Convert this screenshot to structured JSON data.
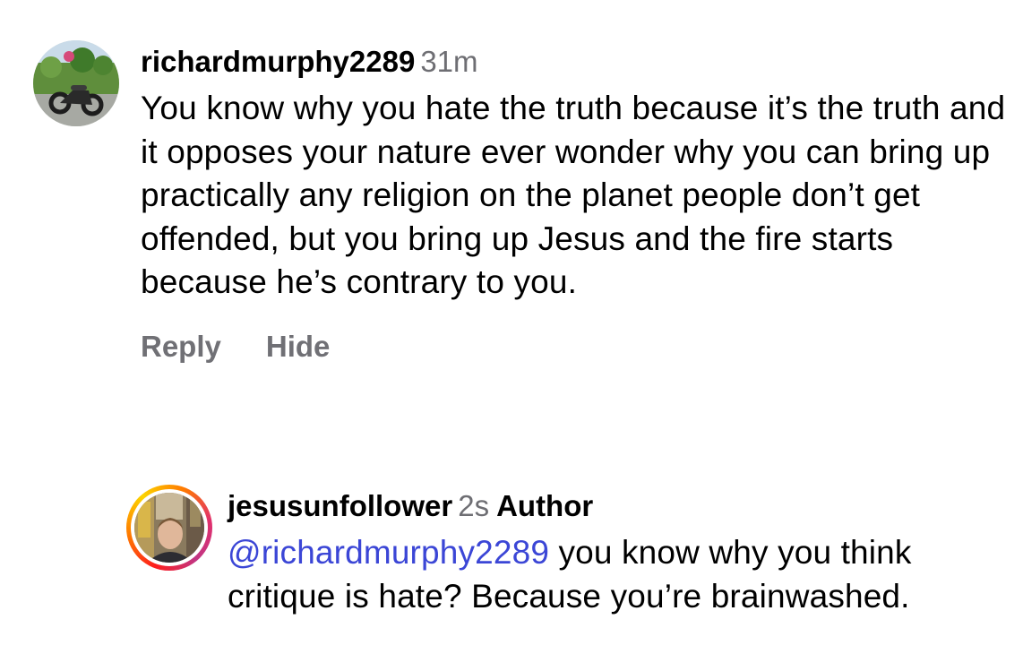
{
  "comments": [
    {
      "username": "richardmurphy2289",
      "time": "31m",
      "text": "You know why you hate the truth because it’s the truth and it opposes your nature ever wonder why you can bring up practically any religion on the planet people don’t get offended, but you bring up Jesus and the fire starts because he’s contrary to you.",
      "actions": {
        "reply": "Reply",
        "hide": "Hide"
      },
      "avatar": "profile-photo-motorcycle"
    },
    {
      "username": "jesusunfollower",
      "time": "2s",
      "badge": "Author",
      "mention": "@richardmurphy2289",
      "text": " you know why you think critique is hate? Because you’re brainwashed.",
      "avatar": "profile-photo-man-city-street",
      "story_ring": true
    }
  ],
  "colors": {
    "mention": "#3b46d6",
    "secondary_text": "#6e6e73",
    "ring_gradient": [
      "#fd1d1d",
      "#ff7a00",
      "#fcd400",
      "#e1306c",
      "#c13584"
    ]
  }
}
